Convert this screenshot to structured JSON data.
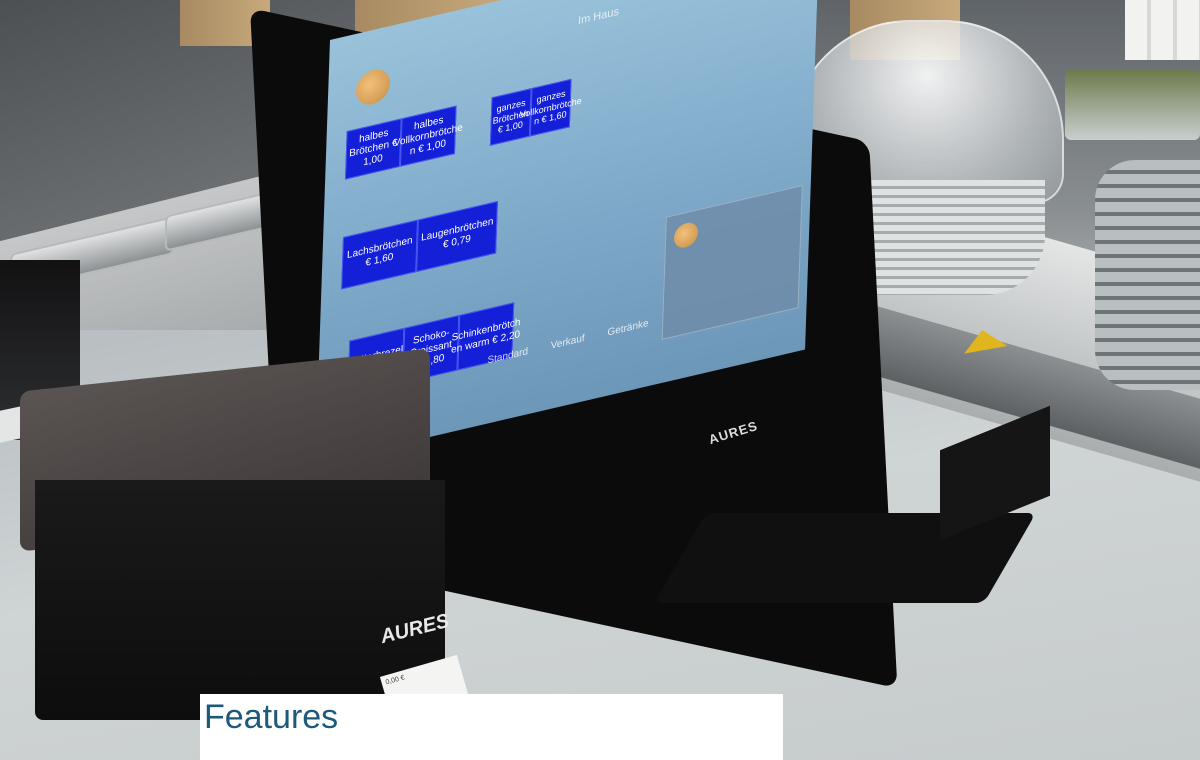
{
  "screen": {
    "title": "Im Haus",
    "tiles": [
      {
        "label": "halbes Brötchen € 1,00"
      },
      {
        "label": "halbes Vollkornbrötche n € 1,00"
      },
      {
        "label": "ganzes Brötchen € 1,00"
      },
      {
        "label": "ganzes Vollkornbrötche n € 1,60"
      },
      {
        "label": "Lachsbrötchen € 1,60"
      },
      {
        "label": "Laugenbrötchen € 0,79"
      },
      {
        "label": "Butterbrezel € 1,20"
      },
      {
        "label": "Schoko-Croissant € 1,80"
      },
      {
        "label": "Schinkenbrötch en warm € 2,20"
      }
    ],
    "menu": [
      "Standard",
      "Verkauf",
      "Getränke"
    ],
    "tile_color": "#1320d8"
  },
  "monitor": {
    "brand": "AURES"
  },
  "printer": {
    "brand": "AURES",
    "receipt": "0,00 €"
  },
  "caption": {
    "title": "Features"
  }
}
